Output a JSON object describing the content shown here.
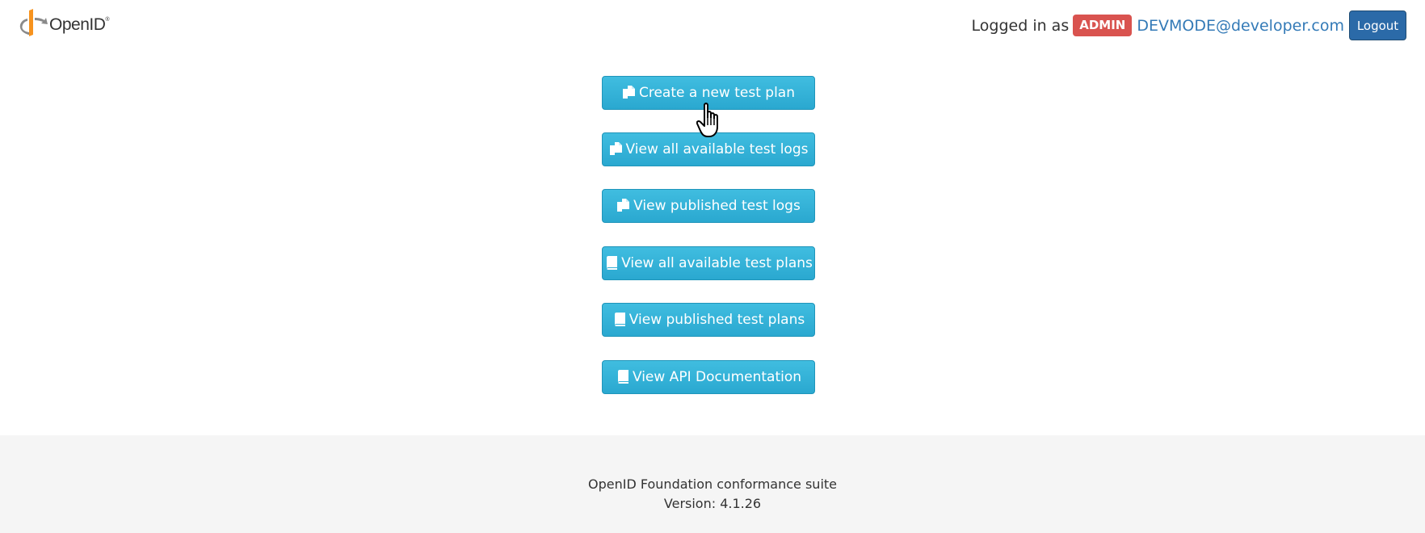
{
  "header": {
    "logo_text": "OpenID",
    "logo_reg": "®",
    "logged_in_label": "Logged in as",
    "role_badge": "ADMIN",
    "user_email": "DEVMODE@developer.com",
    "logout_label": "Logout"
  },
  "menu": {
    "items": [
      {
        "label": "Create a new test plan",
        "icon": "copy-files-icon"
      },
      {
        "label": "View all available test logs",
        "icon": "copy-files-icon"
      },
      {
        "label": "View published test logs",
        "icon": "copy-files-icon"
      },
      {
        "label": "View all available test plans",
        "icon": "book-icon"
      },
      {
        "label": "View published test plans",
        "icon": "book-icon"
      },
      {
        "label": "View API Documentation",
        "icon": "book-icon"
      }
    ]
  },
  "footer": {
    "title": "OpenID Foundation conformance suite",
    "version": "Version: 4.1.26"
  },
  "colors": {
    "button": "#31b0d5",
    "badge": "#d9534f",
    "logout": "#2b6aa8",
    "link": "#337ab7",
    "footer_bg": "#f5f5f5",
    "logo_orange": "#f7931e"
  }
}
